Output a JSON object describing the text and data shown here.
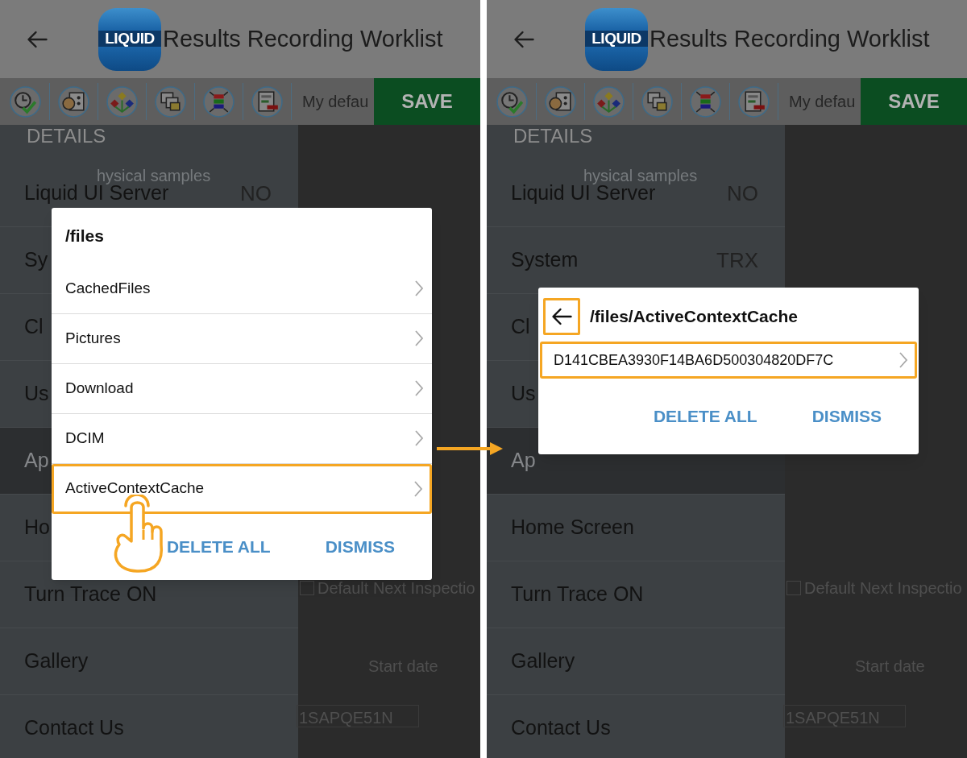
{
  "screens": [
    {
      "header": {
        "logo": "LIQUID",
        "title": "Results Recording Worklist"
      },
      "toolbar": {
        "variant": "My defau",
        "save": "SAVE"
      },
      "section_heading": "DETAILS",
      "drawer": [
        {
          "label": "Liquid UI Server",
          "value": "NO",
          "highlighted": false
        },
        {
          "label": "Sy",
          "highlighted": false
        },
        {
          "label": "Cl",
          "highlighted": false
        },
        {
          "label": "Us",
          "highlighted": false
        },
        {
          "label": "Ap",
          "highlighted": true
        },
        {
          "label": "Ho",
          "highlighted": false
        },
        {
          "label": "Turn Trace ON",
          "highlighted": false
        },
        {
          "label": "Gallery",
          "highlighted": false
        },
        {
          "label": "Contact Us",
          "highlighted": false
        }
      ],
      "background": [
        {
          "kind": "ghost",
          "text": "hysical samples"
        },
        {
          "kind": "checkbox",
          "text": "Default Next Inspectio",
          "checked": false
        },
        {
          "kind": "column",
          "text": "Start date"
        },
        {
          "kind": "field",
          "text": "1SAPQE51N"
        }
      ],
      "dialog": {
        "title": "/files",
        "back": false,
        "items": [
          {
            "label": "CachedFiles",
            "outlined": false,
            "tapped": false
          },
          {
            "label": "Pictures",
            "outlined": false,
            "tapped": false
          },
          {
            "label": "Download",
            "outlined": false,
            "tapped": false
          },
          {
            "label": "DCIM",
            "outlined": false,
            "tapped": false
          },
          {
            "label": "ActiveContextCache",
            "outlined": true,
            "tapped": true
          }
        ],
        "buttons": [
          "DELETE ALL",
          "DISMISS"
        ]
      }
    },
    {
      "header": {
        "logo": "LIQUID",
        "title": "Results Recording Worklist"
      },
      "toolbar": {
        "variant": "My defau",
        "save": "SAVE"
      },
      "section_heading": "DETAILS",
      "drawer": [
        {
          "label": "Liquid UI Server",
          "value": "NO",
          "highlighted": false
        },
        {
          "label": "System",
          "value": "TRX",
          "highlighted": false
        },
        {
          "label": "Cl",
          "highlighted": false
        },
        {
          "label": "Us",
          "highlighted": false
        },
        {
          "label": "Ap",
          "highlighted": true
        },
        {
          "label": "Home Screen",
          "highlighted": false
        },
        {
          "label": "Turn Trace ON",
          "highlighted": false
        },
        {
          "label": "Gallery",
          "highlighted": false
        },
        {
          "label": "Contact Us",
          "highlighted": false
        }
      ],
      "background": [
        {
          "kind": "ghost",
          "text": "hysical samples"
        },
        {
          "kind": "checkbox",
          "text": "Default Next Inspectio",
          "checked": false
        },
        {
          "kind": "column",
          "text": "Start date"
        },
        {
          "kind": "field",
          "text": "1SAPQE51N"
        }
      ],
      "dialog": {
        "title": "/files/ActiveContextCache",
        "back": true,
        "back_outlined": true,
        "items": [
          {
            "label": "D141CBEA3930F14BA6D500304820DF7C",
            "outlined": true,
            "tapped": false
          }
        ],
        "buttons": [
          "DELETE ALL",
          "DISMISS"
        ]
      }
    }
  ]
}
